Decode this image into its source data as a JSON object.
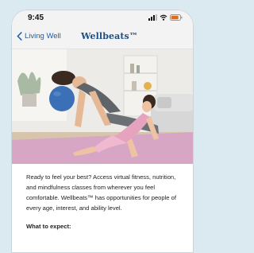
{
  "status_bar": {
    "time": "9:45",
    "icons": [
      "signal-icon",
      "wifi-icon",
      "battery-icon"
    ],
    "battery_color": "#e26b1b"
  },
  "nav": {
    "back_label": "Living Well",
    "back_icon": "chevron-left-icon",
    "title": "Wellbeats™",
    "accent_color": "#1f5ea8"
  },
  "hero_image": {
    "icon": "yoga-photo"
  },
  "content": {
    "intro": "Ready to feel your best? Access virtual fitness, nutrition, and mindfulness classes from wherever you feel comfortable. Wellbeats™ has opportunities for people of every age, interest, and ability level.",
    "section_heading": "What to expect:"
  }
}
